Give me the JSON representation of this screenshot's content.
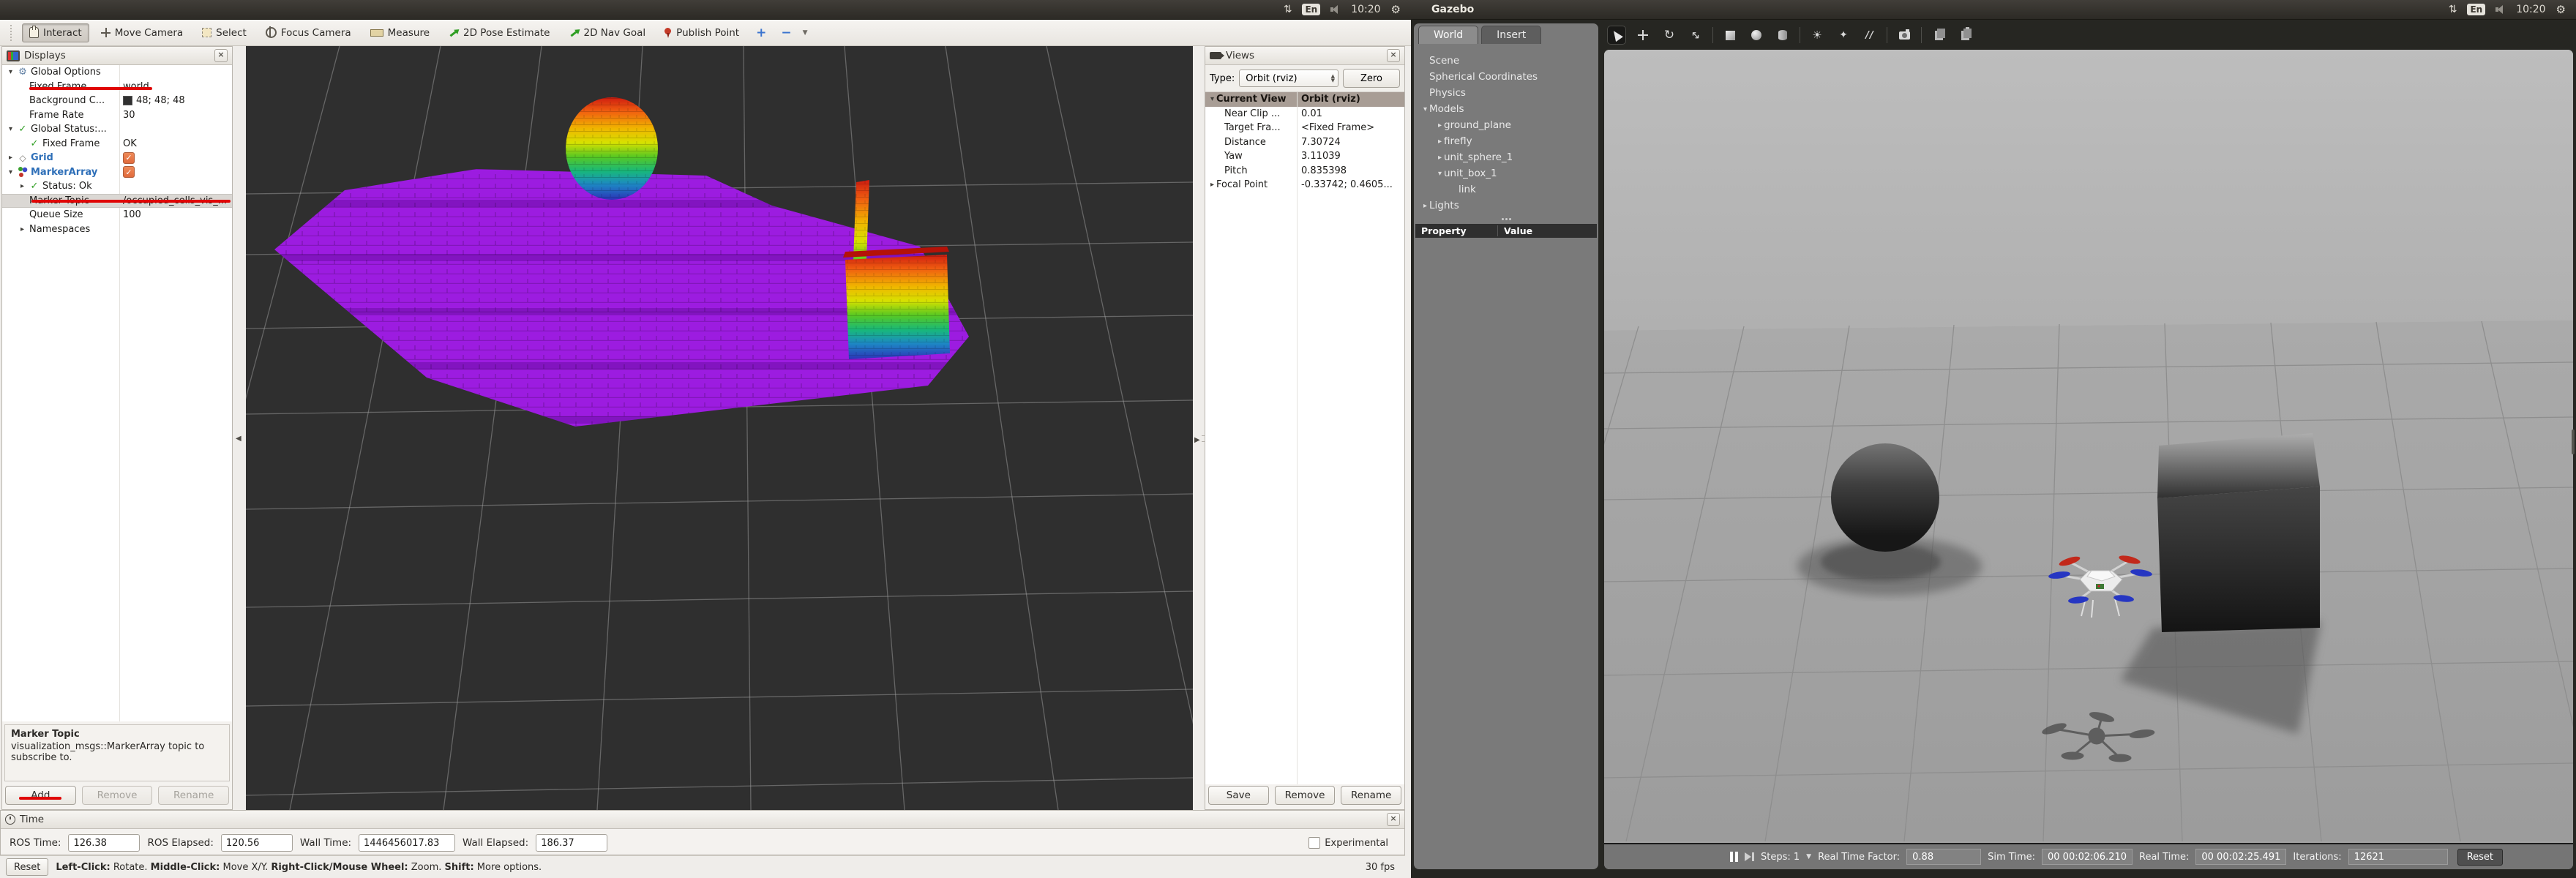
{
  "ubuntu_bar": {
    "lang": "En",
    "time": "10:20",
    "gear": "⚙",
    "updown": "⇅",
    "window_title": "Gazebo"
  },
  "rviz": {
    "toolbar": [
      {
        "label": "Interact",
        "icon": "interact"
      },
      {
        "label": "Move Camera",
        "icon": "move-camera"
      },
      {
        "label": "Select",
        "icon": "select"
      },
      {
        "label": "Focus Camera",
        "icon": "focus-camera"
      },
      {
        "label": "Measure",
        "icon": "measure"
      },
      {
        "label": "2D Pose Estimate",
        "icon": "pose-estimate"
      },
      {
        "label": "2D Nav Goal",
        "icon": "nav-goal"
      },
      {
        "label": "Publish Point",
        "icon": "publish-point"
      }
    ],
    "toolbar_plus": "+",
    "toolbar_minus": "−",
    "displays": {
      "title": "Displays",
      "rows": [
        {
          "arrow": "▾",
          "icon": "gear",
          "label": "Global Options",
          "value": "",
          "lvl": 0
        },
        {
          "arrow": "",
          "icon": "",
          "label": "Fixed Frame",
          "value": "world",
          "lvl": 1
        },
        {
          "arrow": "",
          "icon": "",
          "label": "Background C...",
          "value": "48; 48; 48",
          "swatch": "#303030",
          "lvl": 1
        },
        {
          "arrow": "",
          "icon": "",
          "label": "Frame Rate",
          "value": "30",
          "lvl": 1
        },
        {
          "arrow": "▾",
          "icon": "check",
          "label": "Global Status:...",
          "value": "",
          "lvl": 0
        },
        {
          "arrow": "",
          "icon": "check",
          "label": "Fixed Frame",
          "value": "OK",
          "lvl": 1
        },
        {
          "arrow": "▸",
          "icon": "grid",
          "label": "Grid",
          "value": "",
          "cb": true,
          "em": true,
          "lvl": 0
        },
        {
          "arrow": "▾",
          "icon": "markers",
          "label": "MarkerArray",
          "value": "",
          "cb": true,
          "em": true,
          "lvl": 0
        },
        {
          "arrow": "▸",
          "icon": "check",
          "label": "Status: Ok",
          "value": "",
          "lvl": 1
        },
        {
          "arrow": "",
          "icon": "",
          "label": "Marker Topic",
          "value": "/occupied_cells_vis_...",
          "hl": true,
          "lvl": 1
        },
        {
          "arrow": "",
          "icon": "",
          "label": "Queue Size",
          "value": "100",
          "lvl": 1
        },
        {
          "arrow": "▸",
          "icon": "",
          "label": "Namespaces",
          "value": "",
          "lvl": 1
        }
      ],
      "help_title": "Marker Topic",
      "help_text": "visualization_msgs::MarkerArray topic to subscribe to.",
      "buttons": {
        "add": "Add",
        "remove": "Remove",
        "rename": "Rename"
      }
    },
    "views": {
      "title": "Views",
      "type_label": "Type:",
      "type_value": "Orbit (rviz)",
      "zero_label": "Zero",
      "rows": [
        {
          "arrow": "▾",
          "label": "Current View",
          "value": "Orbit (rviz)",
          "head": true
        },
        {
          "arrow": "",
          "label": "Near Clip ...",
          "value": "0.01"
        },
        {
          "arrow": "",
          "label": "Target Fra...",
          "value": "<Fixed Frame>"
        },
        {
          "arrow": "",
          "label": "Distance",
          "value": "7.30724"
        },
        {
          "arrow": "",
          "label": "Yaw",
          "value": "3.11039"
        },
        {
          "arrow": "",
          "label": "Pitch",
          "value": "0.835398"
        },
        {
          "arrow": "▸",
          "label": "Focal Point",
          "value": "-0.33742; 0.4605..."
        }
      ],
      "buttons": {
        "save": "Save",
        "remove": "Remove",
        "rename": "Rename"
      }
    },
    "time_panel": {
      "title": "Time",
      "fields": [
        {
          "label": "ROS Time:",
          "value": "126.38"
        },
        {
          "label": "ROS Elapsed:",
          "value": "120.56"
        },
        {
          "label": "Wall Time:",
          "value": "1446456017.83"
        },
        {
          "label": "Wall Elapsed:",
          "value": "186.37"
        }
      ],
      "experimental_label": "Experimental"
    },
    "statusbar": {
      "reset_label": "Reset",
      "help": [
        {
          "b": "Left-Click:",
          "t": " Rotate. "
        },
        {
          "b": "Middle-Click:",
          "t": " Move X/Y. "
        },
        {
          "b": "Right-Click/Mouse Wheel:",
          "t": " Zoom. "
        },
        {
          "b": "Shift:",
          "t": " More options."
        }
      ],
      "fps": "30 fps"
    }
  },
  "gazebo": {
    "tabs": {
      "world": "World",
      "insert": "Insert"
    },
    "tree": [
      {
        "arrow": "",
        "label": "Scene",
        "lvl": 0
      },
      {
        "arrow": "",
        "label": "Spherical Coordinates",
        "lvl": 0
      },
      {
        "arrow": "",
        "label": "Physics",
        "lvl": 0
      },
      {
        "arrow": "▾",
        "label": "Models",
        "lvl": 0
      },
      {
        "arrow": "▸",
        "label": "ground_plane",
        "lvl": 1
      },
      {
        "arrow": "▸",
        "label": "firefly",
        "lvl": 1
      },
      {
        "arrow": "▸",
        "label": "unit_sphere_1",
        "lvl": 1
      },
      {
        "arrow": "▾",
        "label": "unit_box_1",
        "lvl": 1
      },
      {
        "arrow": "",
        "label": "link",
        "lvl": 2
      },
      {
        "arrow": "▸",
        "label": "Lights",
        "lvl": 0
      }
    ],
    "property_header": {
      "property": "Property",
      "value": "Value"
    },
    "bottombar": {
      "steps_label": "Steps: 1",
      "rtf_label": "Real Time Factor:",
      "rtf_value": "0.88",
      "sim_label": "Sim Time:",
      "sim_value": "00 00:02:06.210",
      "real_label": "Real Time:",
      "real_value": "00 00:02:25.491",
      "iter_label": "Iterations:",
      "iter_value": "12621",
      "reset_label": "Reset"
    }
  },
  "colors": {
    "annotation_red": "#e00505",
    "rviz_background": "#303030",
    "octomap_purple": "#9c1ce0",
    "checkbox_orange": "#e8734a",
    "display_link_blue": "#2e6fb8",
    "gazebo_sky": "#b8b8b8",
    "gazebo_ground": "#a2a2a2"
  }
}
